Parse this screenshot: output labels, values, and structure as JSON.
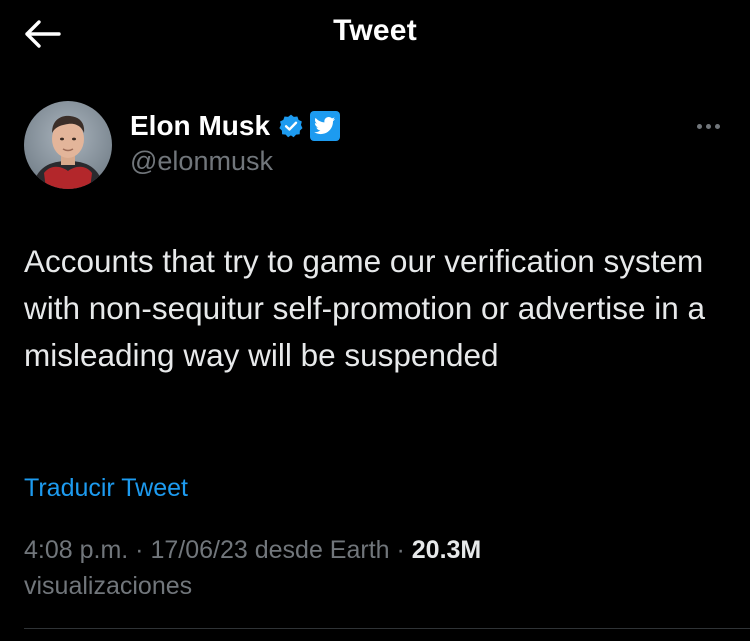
{
  "header": {
    "title": "Tweet",
    "back_icon": "arrow-left-icon"
  },
  "author": {
    "name": "Elon Musk",
    "handle": "@elonmusk",
    "verified_color": "#1d9bf0",
    "affiliate_icon": "twitter-bird-icon"
  },
  "tweet": {
    "text": "Accounts that try to game our verification system with non-sequitur self-promotion or advertise in a misleading way will be suspended",
    "translate_label": "Traducir Tweet",
    "time": "4:08 p.m.",
    "sep1": " · ",
    "date": "17/06/23",
    "source": " desde Earth",
    "sep2": " · ",
    "views_count": "20.3M",
    "views_label": "visualizaciones"
  },
  "colors": {
    "background": "#000000",
    "text": "#e7e9ea",
    "secondary": "#71767b",
    "accent": "#1d9bf0",
    "divider": "#2f3336"
  }
}
